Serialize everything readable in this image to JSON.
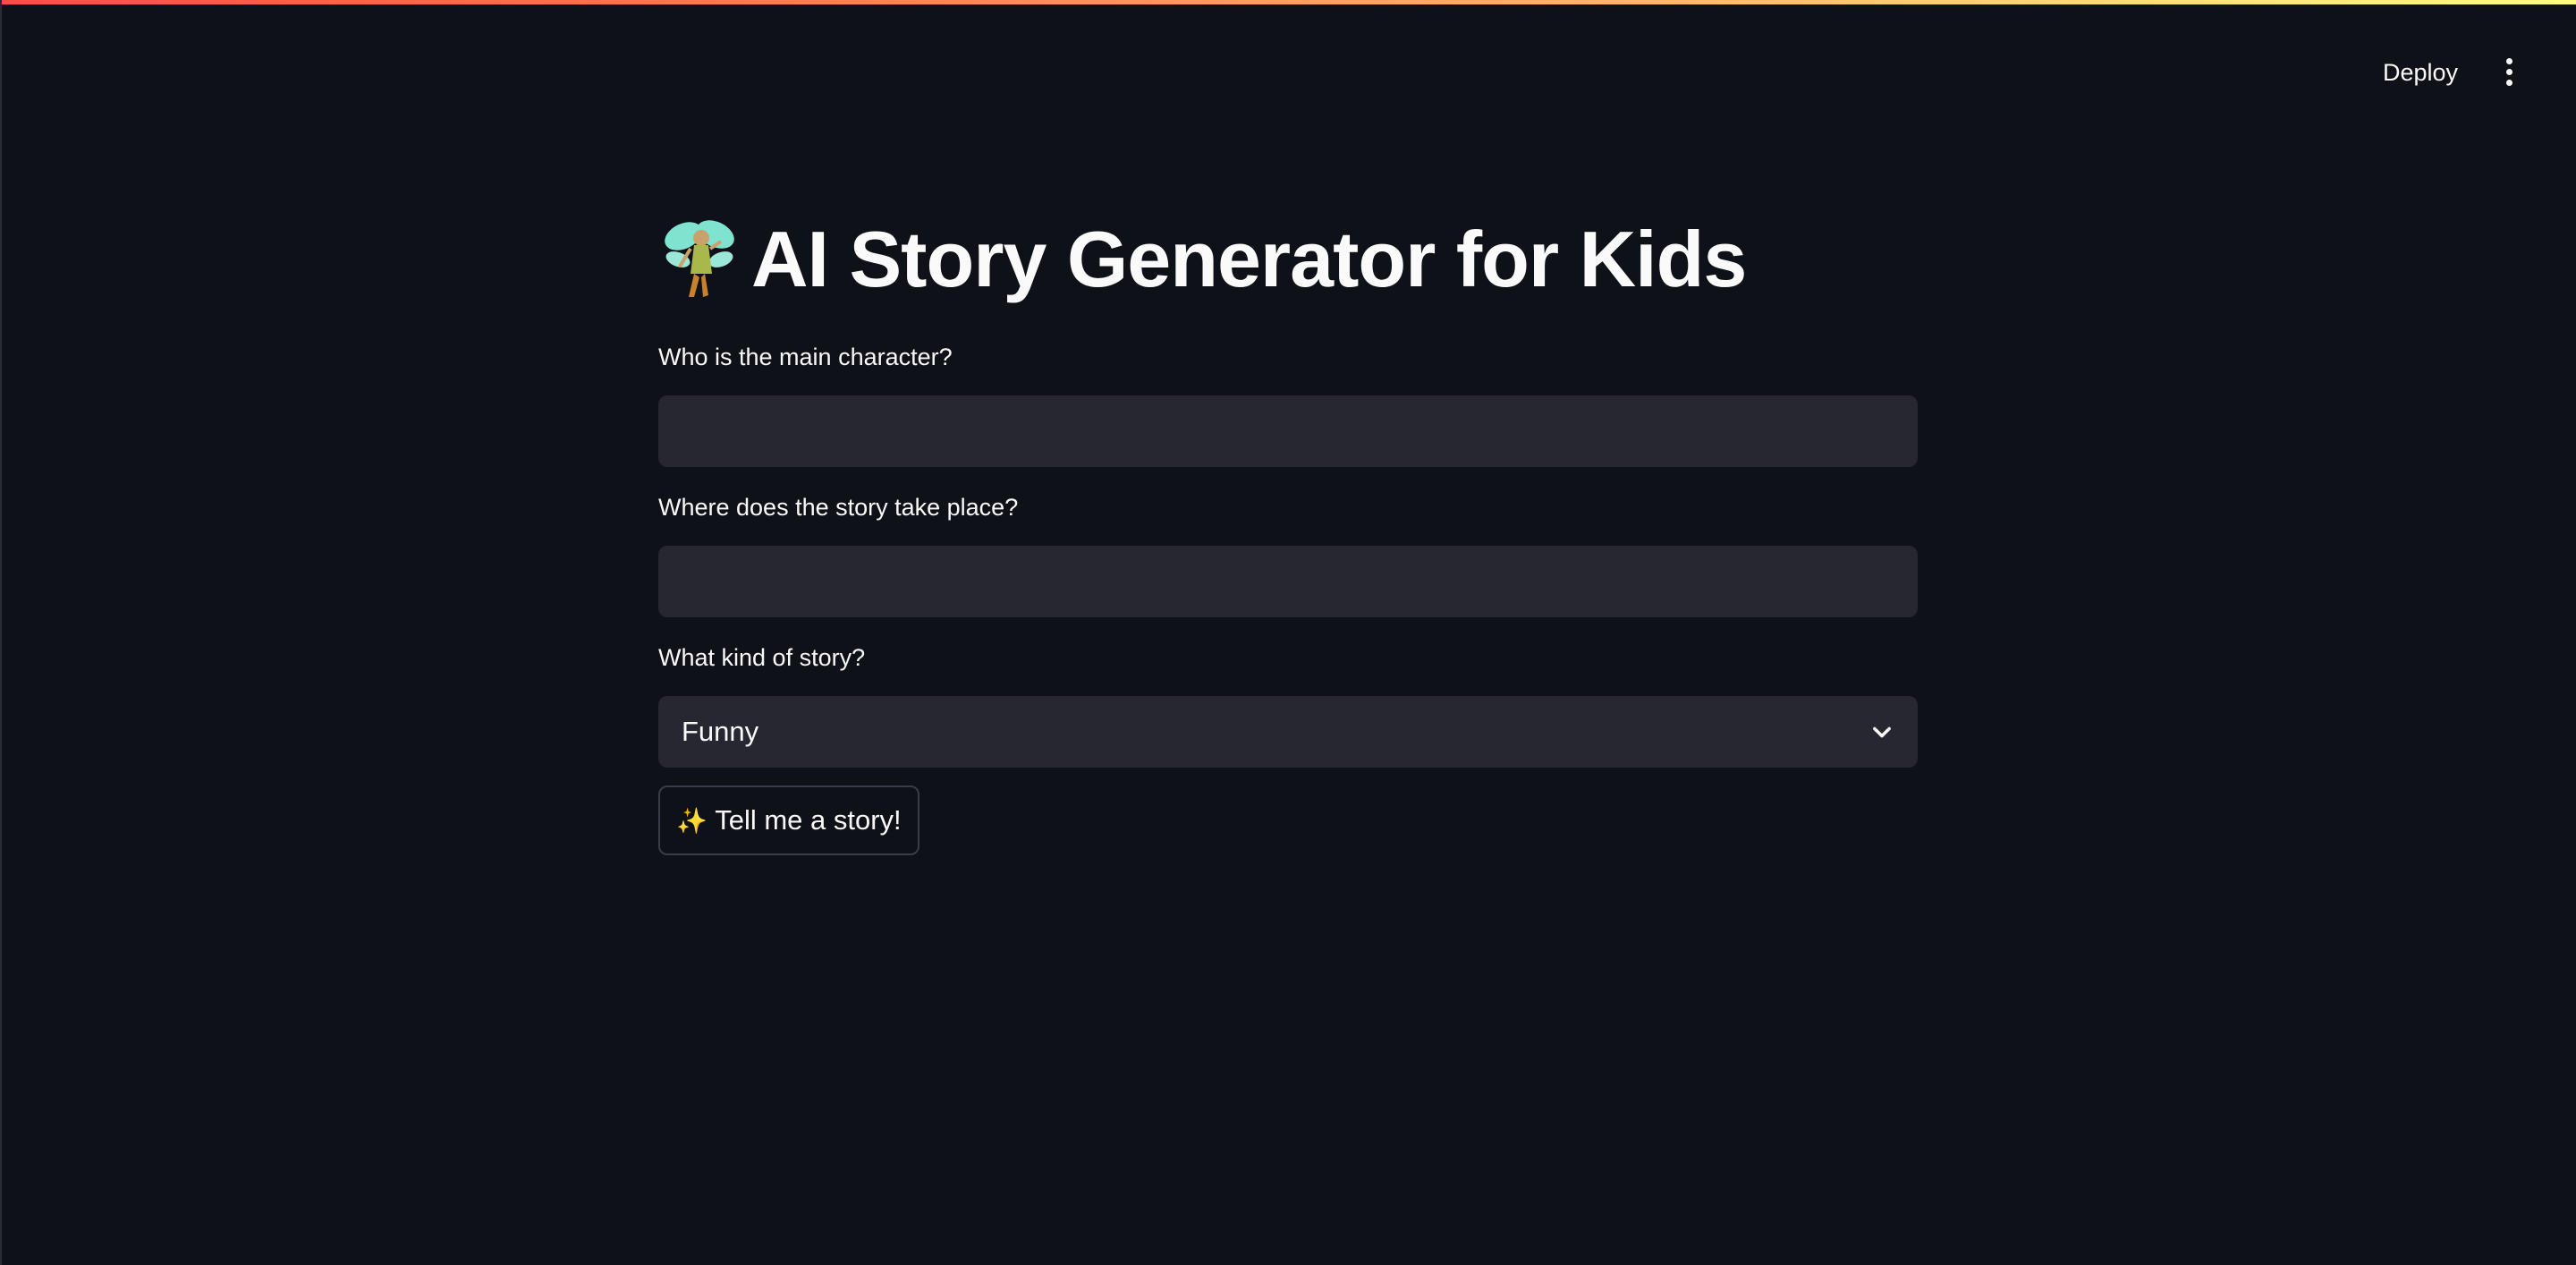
{
  "header": {
    "deploy_label": "Deploy",
    "menu_icon": "more-vertical-icon"
  },
  "main": {
    "title": "AI Story Generator for Kids",
    "title_icon": "fairy-icon",
    "fields": {
      "character": {
        "label": "Who is the main character?",
        "value": "",
        "placeholder": ""
      },
      "setting": {
        "label": "Where does the story take place?",
        "value": "",
        "placeholder": ""
      },
      "story_type": {
        "label": "What kind of story?",
        "selected": "Funny"
      }
    },
    "submit_button": {
      "icon": "sparkles-icon",
      "label": "Tell me a story!"
    }
  },
  "colors": {
    "background": "#0e1117",
    "input_background": "#262730",
    "text": "#fafafa",
    "accent_gradient_start": "#ff4b4b",
    "accent_gradient_end": "#fffd80"
  }
}
